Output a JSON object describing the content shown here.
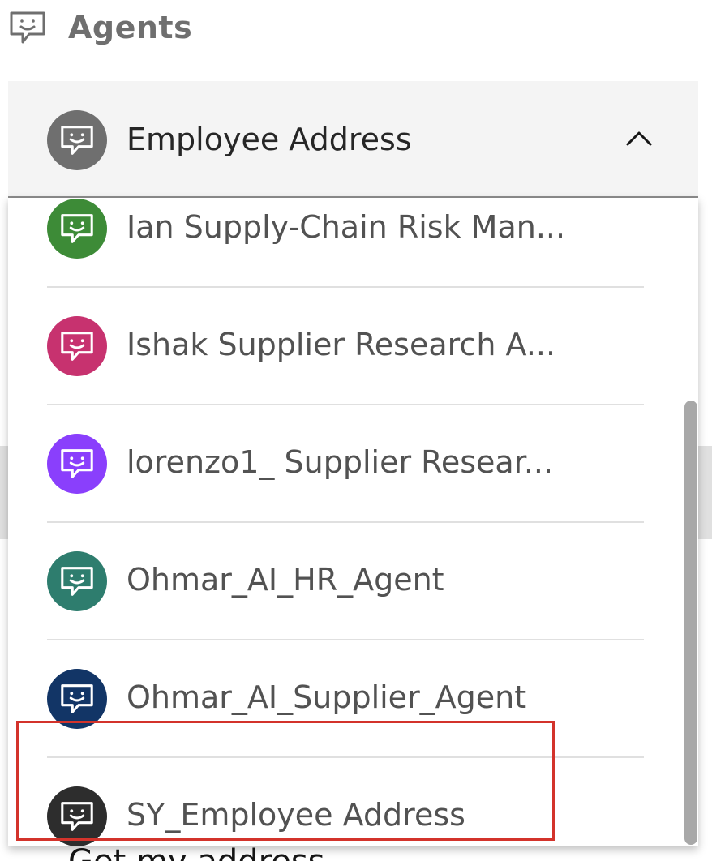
{
  "header": {
    "title": "Agents",
    "icon": "chat-bot-icon"
  },
  "background": {
    "bottom_text": "Get my address"
  },
  "select": {
    "value": "Employee Address",
    "avatar_color": "#6f6f6f",
    "expanded": true
  },
  "menu": {
    "items": [
      {
        "label": "Ian Supply-Chain Risk Man...",
        "avatar_color": "#3d8b37"
      },
      {
        "label": "Ishak Supplier Research A...",
        "avatar_color": "#c7326f"
      },
      {
        "label": "lorenzo1_ Supplier Resear...",
        "avatar_color": "#8a3ffc"
      },
      {
        "label": "Ohmar_AI_HR_Agent",
        "avatar_color": "#2e7d6e"
      },
      {
        "label": "Ohmar_AI_Supplier_Agent",
        "avatar_color": "#123566"
      },
      {
        "label": "SY_Employee Address",
        "avatar_color": "#2d2d2d"
      }
    ]
  },
  "colors": {
    "highlight": "#d3332b",
    "field_bg": "#f4f4f4",
    "divider": "#e0e0e0"
  }
}
